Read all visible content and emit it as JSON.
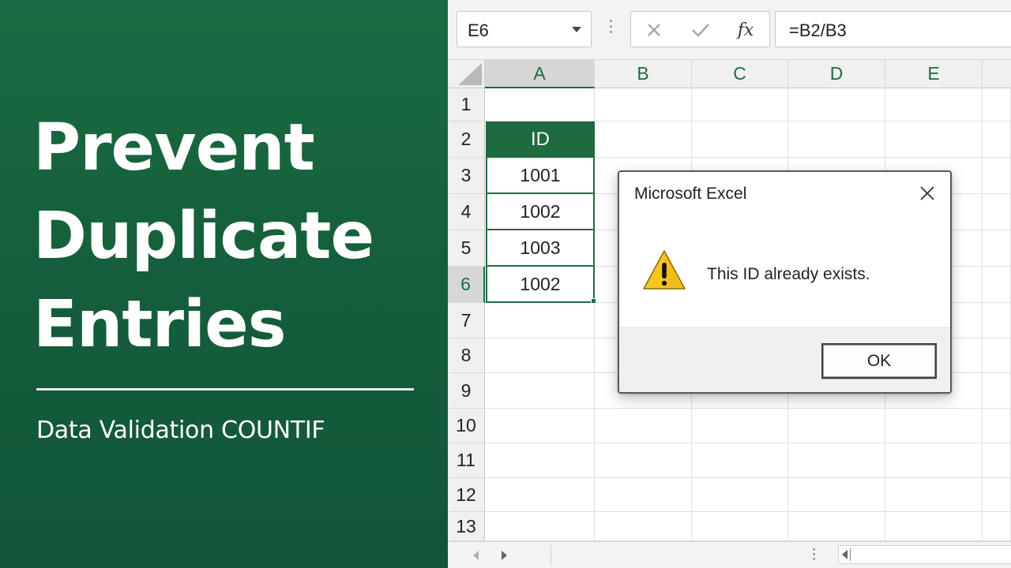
{
  "banner": {
    "title_lines": [
      "Prevent",
      "Duplicate",
      "Entries"
    ],
    "subtitle": "Data Validation COUNTIF"
  },
  "formula_bar": {
    "name_box": "E6",
    "cancel_icon": "close-icon",
    "enter_icon": "check-icon",
    "function_label": "fx",
    "formula": "=B2/B3"
  },
  "grid": {
    "columns": [
      "A",
      "B",
      "C",
      "D",
      "E"
    ],
    "active_column": "A",
    "rows": [
      "1",
      "2",
      "3",
      "4",
      "5",
      "6",
      "7",
      "8",
      "9",
      "10",
      "11",
      "12",
      "13"
    ],
    "active_row": "6",
    "header_cell": "ID",
    "values": [
      "1001",
      "1002",
      "1003",
      "1002"
    ]
  },
  "dialog": {
    "title": "Microsoft Excel",
    "message": "This ID already exists.",
    "ok_label": "OK",
    "icon": "warning-icon"
  },
  "colors": {
    "excel_green": "#1d6b3f",
    "banner_green": "#155e3b",
    "warning_yellow": "#f7c623"
  }
}
